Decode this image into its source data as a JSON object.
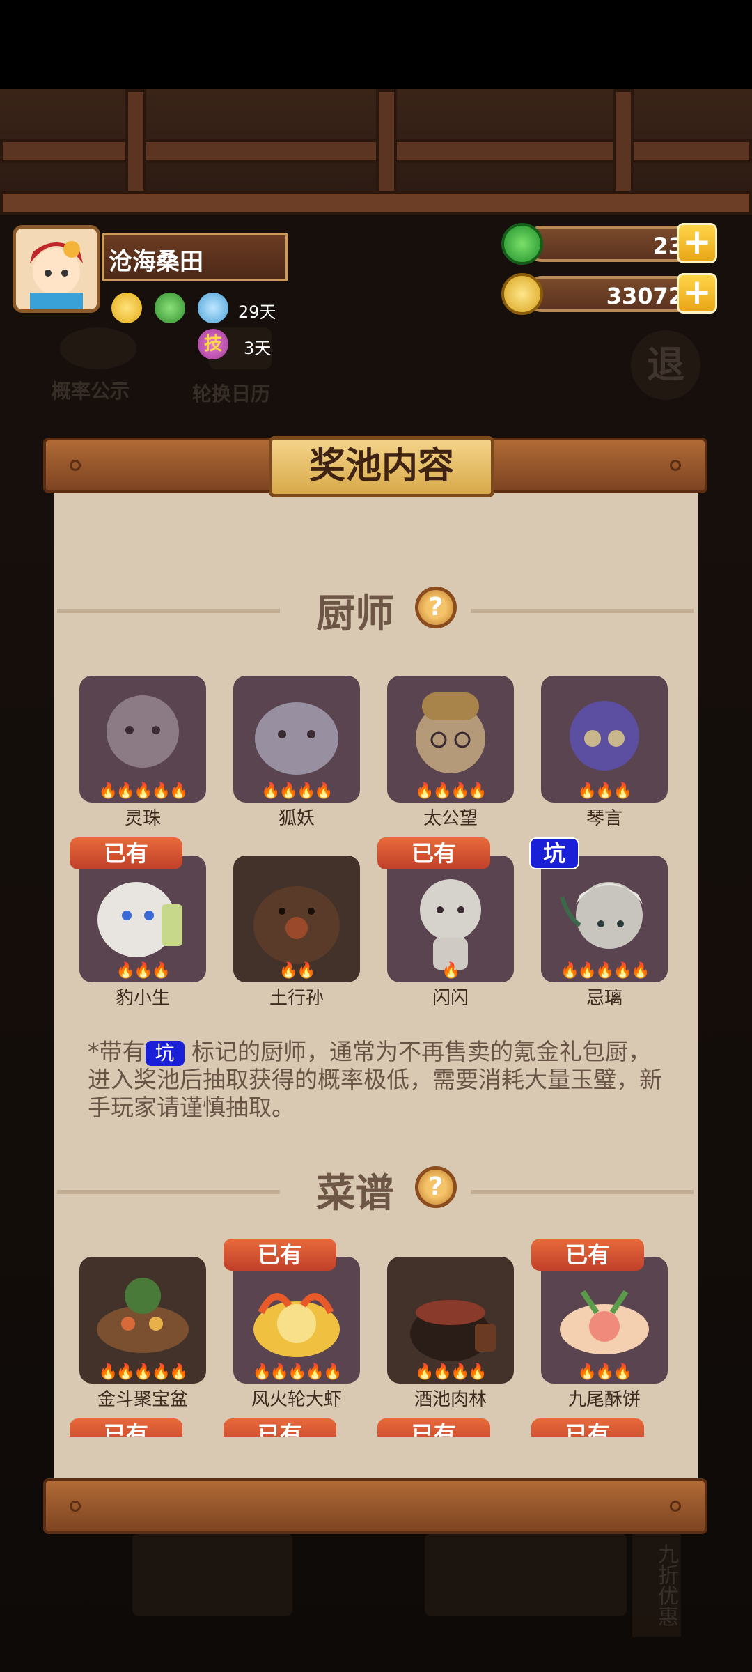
{
  "profile": {
    "name": "沧海桑田",
    "buffs": [
      {
        "label": "29天",
        "icons": [
          "gold-coin-up-icon",
          "jade-up-icon",
          "plate-up-icon"
        ]
      },
      {
        "label": "3天",
        "icons": [
          "skill-up-icon"
        ]
      }
    ],
    "skill_icon_text": "技"
  },
  "currency": {
    "jade": "23",
    "coins": "33072",
    "plus": "+"
  },
  "background": {
    "prob_label": "概率公示",
    "calendar_label": "轮换日历",
    "exit_label": "退",
    "bottom_side_label": "九折优惠"
  },
  "panel": {
    "title": "奖池内容",
    "chef_section_title": "厨师",
    "recipe_section_title": "菜谱",
    "help": "?",
    "owned_label": "已有",
    "keng_label": "坑",
    "notice_prefix": "*带有",
    "notice_suffix": "标记的厨师，通常为不再售卖的氪金礼包厨，进入奖池后抽取获得的概率极低，需要消耗大量玉璧，新手玩家请谨慎抽取。",
    "chefs": [
      {
        "name": "灵珠",
        "stars": 5
      },
      {
        "name": "狐妖",
        "stars": 4
      },
      {
        "name": "太公望",
        "stars": 4
      },
      {
        "name": "琴言",
        "stars": 3
      },
      {
        "name": "豹小生",
        "stars": 3,
        "owned": true
      },
      {
        "name": "土行孙",
        "stars": 2
      },
      {
        "name": "闪闪",
        "stars": 1,
        "owned": true
      },
      {
        "name": "忌璃",
        "stars": 5,
        "keng": true
      }
    ],
    "recipes": [
      {
        "name": "金斗聚宝盆",
        "stars": 5
      },
      {
        "name": "风火轮大虾",
        "stars": 5,
        "owned": true
      },
      {
        "name": "酒池肉林",
        "stars": 4
      },
      {
        "name": "九尾酥饼",
        "stars": 3,
        "owned": true
      }
    ]
  }
}
